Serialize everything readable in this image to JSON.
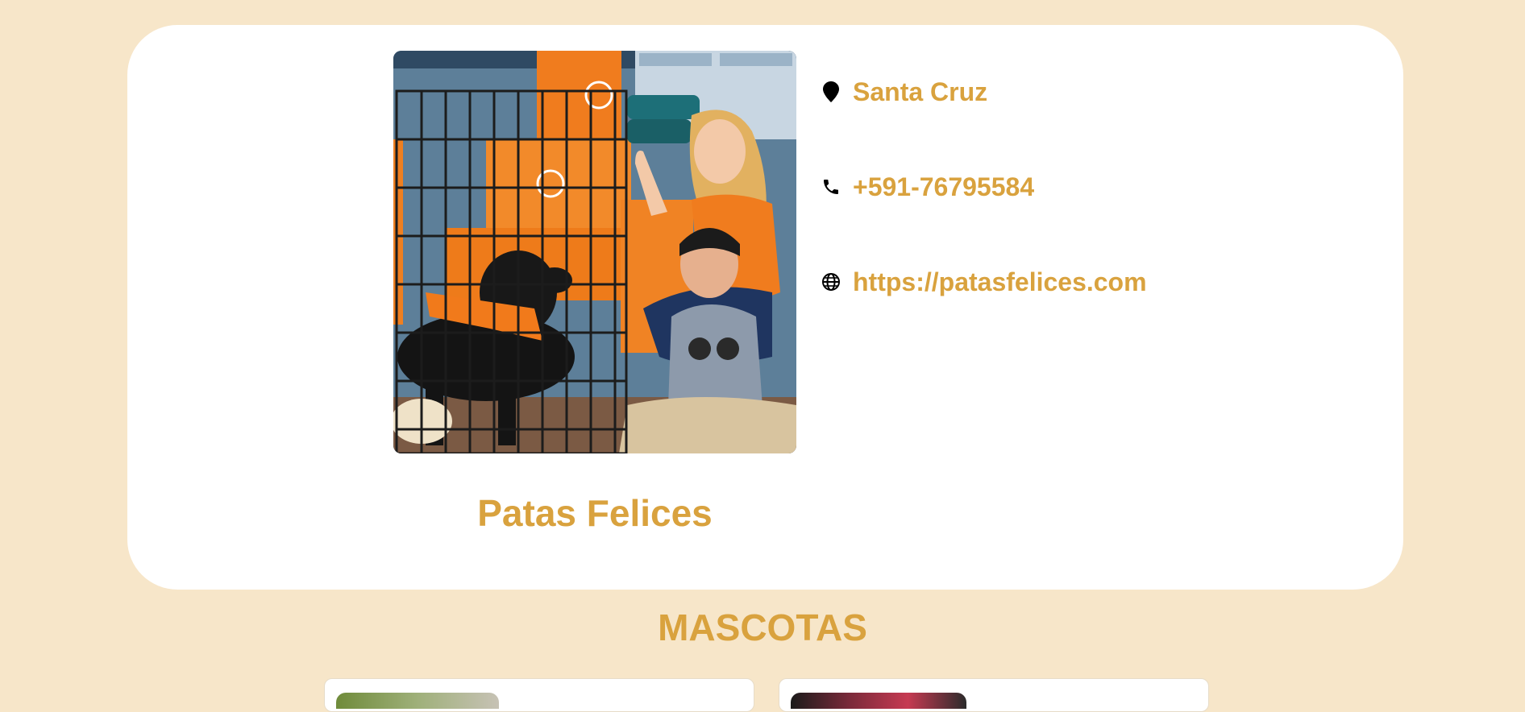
{
  "shelter": {
    "name": "Patas Felices",
    "photo_alt": "Volunteer with child and black dog in a kennel at a pet adoption event",
    "contact": {
      "location": "Santa Cruz",
      "phone": "+591-76795584",
      "website": "https://patasfelices.com"
    }
  },
  "pets_section": {
    "title": "MASCOTAS"
  },
  "colors": {
    "accent": "#d9a23e",
    "page_background": "#f7e6c9",
    "card_background": "#ffffff"
  },
  "icons": {
    "location": "map-pin-icon",
    "phone": "phone-icon",
    "website": "globe-icon"
  }
}
